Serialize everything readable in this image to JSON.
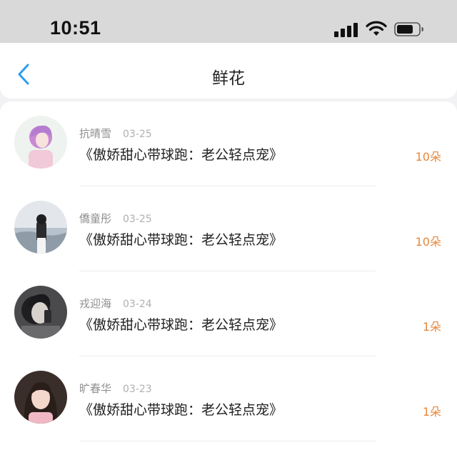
{
  "status_bar": {
    "time": "10:51"
  },
  "header": {
    "title": "鲜花"
  },
  "records": [
    {
      "name": "抗晴雪",
      "date": "03-25",
      "book": "《傲娇甜心带球跑：老公轻点宠》",
      "amount": "10朵"
    },
    {
      "name": "僑童彤",
      "date": "03-25",
      "book": "《傲娇甜心带球跑：老公轻点宠》",
      "amount": "10朵"
    },
    {
      "name": "戎迎海",
      "date": "03-24",
      "book": "《傲娇甜心带球跑：老公轻点宠》",
      "amount": "1朵"
    },
    {
      "name": "旷春华",
      "date": "03-23",
      "book": "《傲娇甜心带球跑：老公轻点宠》",
      "amount": "1朵"
    }
  ],
  "colors": {
    "accent": "#2b9ef0",
    "amount": "#e5883d",
    "title": "#222222"
  },
  "icons": {
    "back": "back-chevron-icon",
    "signal": "signal-icon",
    "wifi": "wifi-icon",
    "battery": "battery-icon"
  }
}
